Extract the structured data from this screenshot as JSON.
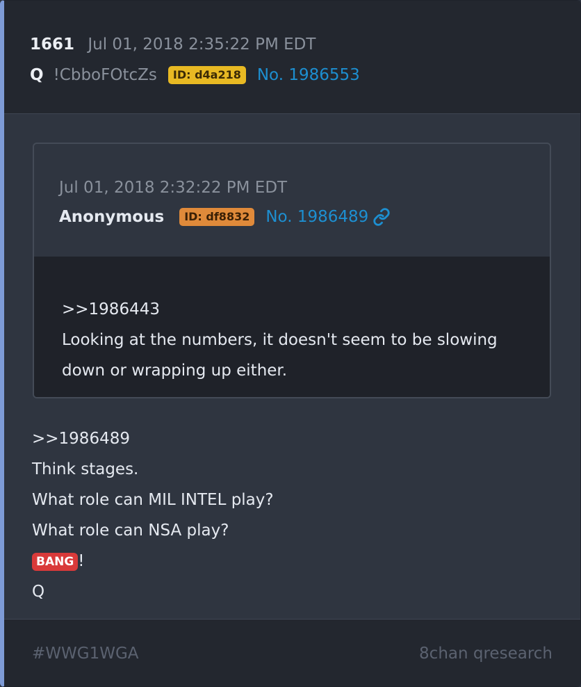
{
  "post": {
    "number": "1661",
    "date": "Jul 01, 2018 2:35:22 PM EDT",
    "author": "Q",
    "tripcode": "!CbboFOtcZs",
    "id_badge": "ID: d4a218",
    "post_no": "No. 1986553"
  },
  "quoted": {
    "date": "Jul 01, 2018 2:32:22 PM EDT",
    "author": "Anonymous",
    "id_badge": "ID: df8832",
    "post_no": "No. 1986489",
    "body": [
      ">>1986443",
      "Looking at the numbers, it doesn't seem to be slowing",
      "down or wrapping up either."
    ]
  },
  "body": {
    "lines": [
      ">>1986489",
      "Think stages.",
      "What role can MIL INTEL play?",
      "What role can NSA play?"
    ],
    "bang_label": "BANG",
    "bang_suffix": "!",
    "signature": "Q"
  },
  "footer": {
    "hashtag": "#WWG1WGA",
    "source": "8chan qresearch"
  },
  "colors": {
    "accent_border": "#7e9bd6",
    "link": "#1d8fd1",
    "q_badge": "#e8b923",
    "anon_badge": "#e08a3a",
    "bang": "#d93a3a"
  },
  "icons": [
    "link-icon"
  ]
}
